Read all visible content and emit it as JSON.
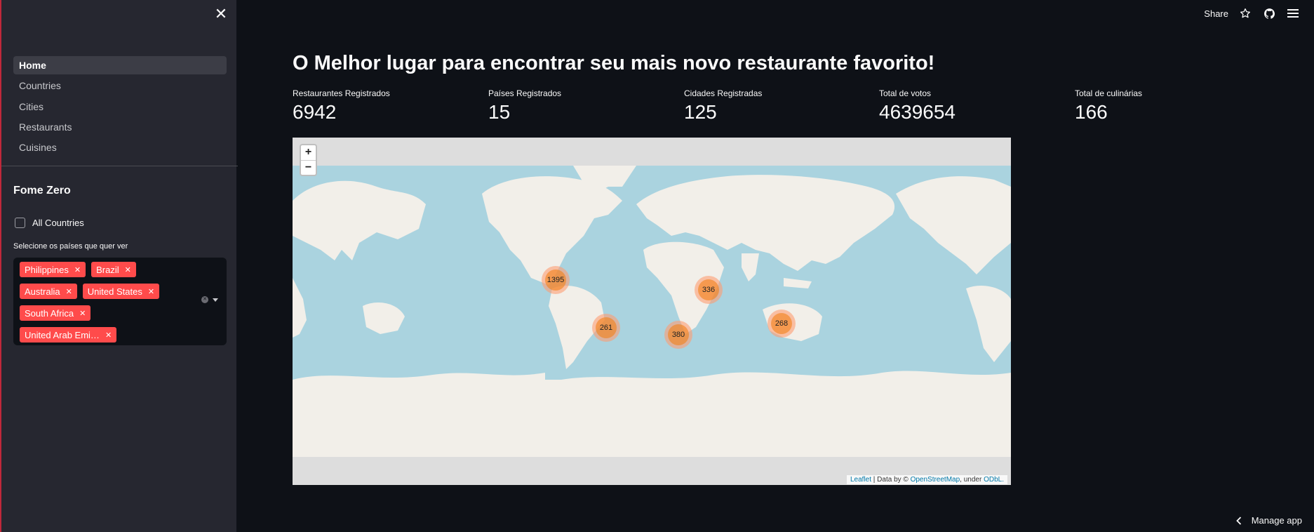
{
  "sidebar": {
    "nav": [
      "Home",
      "Countries",
      "Cities",
      "Restaurants",
      "Cuisines"
    ],
    "title": "Fome Zero",
    "checkbox_label": "All Countries",
    "select_label": "Selecione os países que quer ver",
    "selected_countries": [
      "Philippines",
      "Brazil",
      "Australia",
      "United States",
      "South Africa",
      "United Arab Emirates"
    ],
    "tag_display": [
      "Philippines",
      "Brazil",
      "Australia",
      "United States",
      "South Africa",
      "United Arab Emi…"
    ]
  },
  "toolbar": {
    "share_label": "Share",
    "icons": [
      "star-icon",
      "github-icon",
      "hamburger-menu-icon"
    ]
  },
  "main": {
    "title": "O Melhor lugar para encontrar seu mais novo restaurante favorito!",
    "metrics": [
      {
        "label": "Restaurantes Registrados",
        "value": "6942"
      },
      {
        "label": "Países Registrados",
        "value": "15"
      },
      {
        "label": "Cidades Registradas",
        "value": "125"
      },
      {
        "label": "Total de votos",
        "value": "4639654"
      },
      {
        "label": "Total de culinárias",
        "value": "166"
      }
    ]
  },
  "map": {
    "zoom_in": "+",
    "zoom_out": "−",
    "clusters": [
      "1395",
      "261",
      "380",
      "336",
      "268"
    ],
    "attribution": {
      "leaflet": "Leaflet",
      "sep": " | Data by © ",
      "osm": "OpenStreetMap",
      "under": ", under ",
      "odbl": "ODbL."
    },
    "colors": {
      "water": "#aad3df",
      "land": "#f2efe9",
      "background": "#dddddd"
    }
  },
  "footer": {
    "manage_label": "Manage app"
  }
}
